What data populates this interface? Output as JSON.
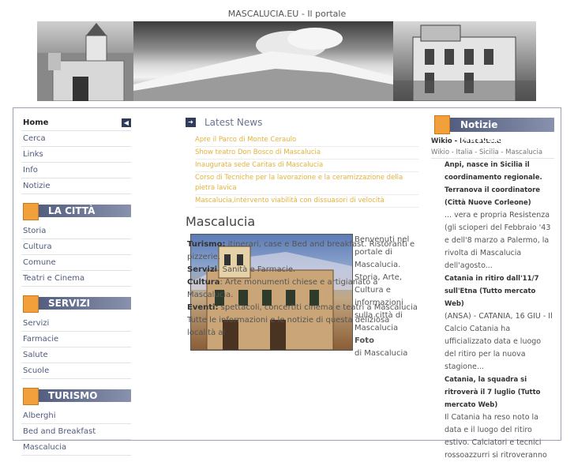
{
  "header": {
    "site_title": "MASCALUCIA.EU - Il portale"
  },
  "left_menu": {
    "top_items": [
      {
        "label": "Home"
      },
      {
        "label": "Cerca"
      },
      {
        "label": "Links"
      },
      {
        "label": "Info"
      },
      {
        "label": "Notizie"
      }
    ],
    "sections": [
      {
        "title": "LA CITTÀ",
        "items": [
          "Storia",
          "Cultura",
          "Comune",
          "Teatri e Cinema"
        ]
      },
      {
        "title": "SERVIZI",
        "items": [
          "Servizi",
          "Farmacie",
          "Salute",
          "Scuole"
        ]
      },
      {
        "title": "TURISMO",
        "items": [
          "Alberghi",
          "Bed and Breakfast",
          "Mascalucia"
        ]
      }
    ]
  },
  "main": {
    "news_title": "Latest News",
    "news": [
      "Apre il Parco di Monte Ceraulo",
      "Show teatro Don Bosco di Mascalucia",
      "Inaugurata sede Caritas di Mascalucia",
      "Corso di Tecniche per la lavorazione e la ceramizzazione della pietra lavica",
      "Mascalucia,intervento viabilità con dissuasori di velocità"
    ],
    "page_title": "Mascalucia",
    "intro_lines": [
      "Benvenuti nel",
      "portale di",
      "Mascalucia.",
      "Storia, Arte,",
      "Cultura e",
      "informazioni",
      "sulla città di",
      "Mascalucia"
    ],
    "intro_foto_label": "Foto",
    "intro_foto_rest": "di Mascalucia",
    "paragraphs": [
      {
        "label": "Turismo:",
        "text": " itinerari, case e Bed and breakfast. Ristoranti e pizzerie."
      },
      {
        "label": "Servizi",
        "text": ": Sanità e Farmacie."
      },
      {
        "label": "Cultura",
        "text": ": Arte monumenti chiese e artigianato a Mascalucia."
      },
      {
        "label": "Eventi:",
        "text": " spettacoli, concertiti cinema e teatri  a Mascalucia"
      },
      {
        "label": "",
        "text": "Tutte le informazioni e le notizie di questa deliziosa località ai"
      }
    ]
  },
  "right": {
    "title": "Notizie Mascalucia",
    "wikio_title": "Wikio - Mascalucia",
    "wikio_crumb": "Wikio - Italia - Sicilia - Mascalucia",
    "feed": [
      {
        "headline": "Anpi, nasce in Sicilia il coordinamento regionale. Terranova il coordinatore (Città Nuove Corleone)",
        "text": "... vera e propria Resistenza (gli scioperi del Febbraio '43 e dell'8 marzo a Palermo, la rivolta di Mascalucia dell'agosto..."
      },
      {
        "headline": "Catania in ritiro dall'11/7 sull'Etna (Tutto mercato Web)",
        "text": "(ANSA) - CATANIA, 16 GIU - Il Calcio Catania ha ufficializzato data e luogo del ritiro per la nuova stagione..."
      },
      {
        "headline": "Catania, la squadra si ritroverà il 7 luglio (Tutto mercato Web)",
        "text": "Il Catania ha reso noto la data e il luogo del ritiro estivo. Calciatori e tecnici rossoazzurri si ritroveranno"
      }
    ]
  },
  "icons": {
    "back": "back-arrow-icon",
    "news": "arrow-icon"
  }
}
